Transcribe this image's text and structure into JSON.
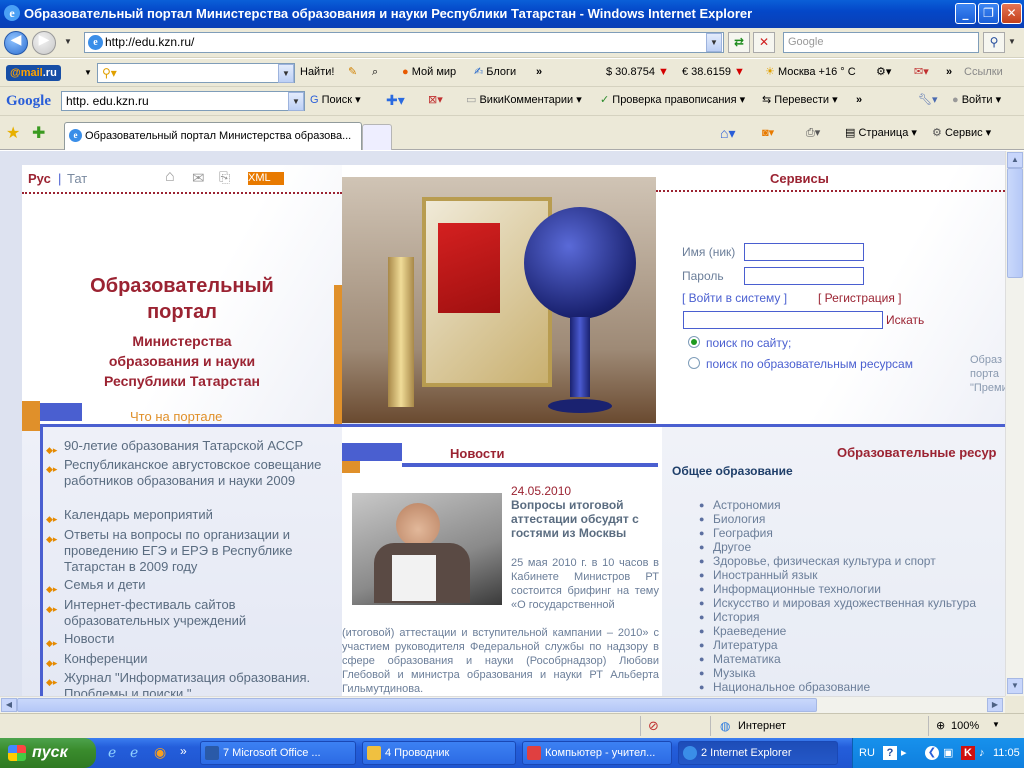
{
  "window": {
    "title": "Образовательный портал Министерства образования и науки Республики Татарстан - Windows Internet Explorer"
  },
  "address": {
    "url": "http://edu.kzn.ru/",
    "search_placeholder": "Google"
  },
  "mail_toolbar": {
    "logo_mail": "@mail",
    "logo_ru": ".ru",
    "find": "Найти!",
    "moy_mir": "Мой мир",
    "blogi": "Блоги",
    "usd": "$ 30.8754",
    "eur": "€ 38.6159",
    "weather": "Москва +16 ° С",
    "links": "Ссылки"
  },
  "google_toolbar": {
    "logo": "Google",
    "query": "http. edu.kzn.ru",
    "search": "Поиск",
    "wiki": "ВикиКомментарии",
    "spell": "Проверка правописания",
    "translate": "Перевести",
    "login": "Войти"
  },
  "tabs": {
    "active_title": "Образовательный портал Министерства образова...",
    "page_menu": "Страница",
    "service_menu": "Сервис"
  },
  "site": {
    "lang_ru": "Рус",
    "lang_sep": "|",
    "lang_tat": "Тат",
    "xml": "XML",
    "title1": "Образовательный",
    "title2": "портал",
    "sub1": "Министерства",
    "sub2": "образования и науки",
    "sub3": "Республики Татарстан",
    "whats_on": "Что на портале",
    "services_title": "Сервисы",
    "login_label": "Имя (ник)",
    "password_label": "Пароль",
    "login_link": "[ Войти в систему ]",
    "register_link": "[ Регистрация ]",
    "search_btn": "Искать",
    "radio_site": "поиск по сайту;",
    "radio_edu": "поиск по образовательным ресурсам",
    "side_text1": "Образ",
    "side_text2": "порта",
    "side_text3": "\"Преми",
    "news_title": "Новости",
    "news_date": "24.05.2010",
    "news_headline": "Вопросы итоговой аттестации обсудят с гостями из Москвы",
    "news_text_a": "25 мая 2010 г. в 10 часов в Кабинете Министров РТ состоится брифинг на тему «О государственной",
    "news_text_b": "(итоговой) аттестации и вступительной кампании – 2010» с участием руководителя Федеральной службы по надзору в сфере образования и науки (Рособрнадзор) Любови Глебовой и министра образования и науки РТ Альберта Гильмутдинова.",
    "resources_title": "Образовательные ресур",
    "general_edu": "Общее образование",
    "menu": [
      "90-летие образования Татарской АССР",
      "Республиканское августовское совещание работников образования и науки 2009",
      "Календарь мероприятий",
      "Ответы на вопросы по организации и проведению ЕГЭ и ЕРЭ в Республике Татарстан в 2009 году",
      "Семья и дети",
      "Интернет-фестиваль сайтов образовательных учреждений",
      "Новости",
      "Конференции",
      "Журнал \"Информатизация образования. Проблемы и поиски.\""
    ],
    "subjects": [
      "Астрономия",
      "Биология",
      "География",
      "Другое",
      "Здоровье, физическая культура и спорт",
      "Иностранный язык",
      "Информационные технологии",
      "Искусство и мировая художественная культура",
      "История",
      "Краеведение",
      "Литература",
      "Математика",
      "Музыка",
      "Национальное образование"
    ]
  },
  "statusbar": {
    "zone": "Интернет",
    "zoom": "100%"
  },
  "taskbar": {
    "start": "пуск",
    "tasks": [
      "7 Microsoft Office ...",
      "4 Проводник",
      "Компьютер - учител...",
      "2 Internet Explorer"
    ],
    "lang": "RU",
    "clock": "11:05"
  },
  "colors": {
    "accent_red": "#9b2332",
    "accent_orange": "#e0902a",
    "accent_blue": "#4a5fd0"
  }
}
